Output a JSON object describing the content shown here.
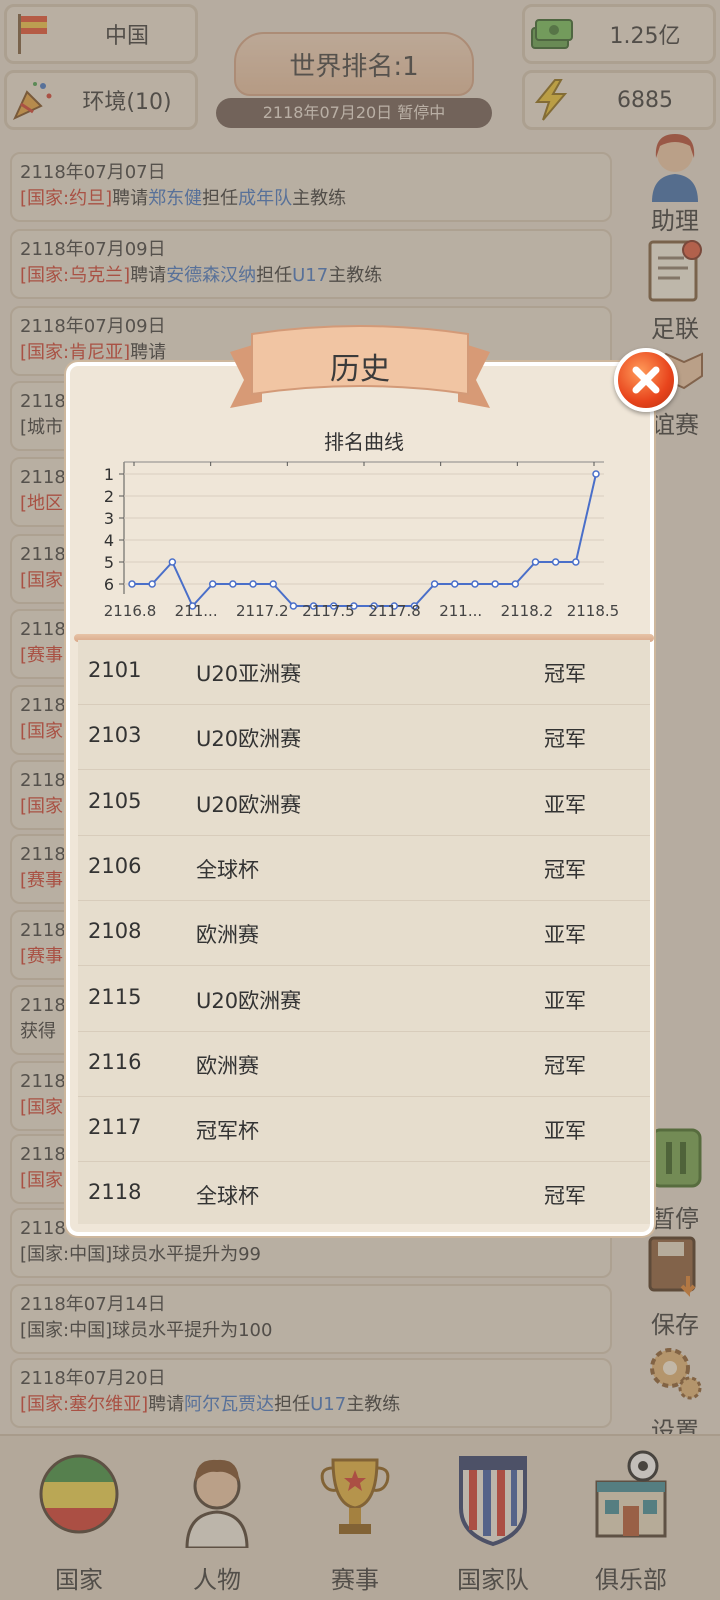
{
  "header": {
    "country": "中国",
    "environment": "环境(10)",
    "money": "1.25亿",
    "energy": "6885",
    "rank_title": "世界排名:1",
    "date_status": "2118年07月20日 暂停中"
  },
  "side_menu": {
    "assistant": "助理",
    "league": "足联",
    "friendly": "谊赛",
    "pause": "暂停",
    "save": "保存",
    "settings": "设置"
  },
  "news": [
    {
      "date": "2118年07月07日",
      "parts": [
        {
          "t": "[国家:约旦]",
          "c": "red"
        },
        {
          "t": "聘请",
          "c": "dark"
        },
        {
          "t": "郑东健",
          "c": "blue"
        },
        {
          "t": "担任",
          "c": "dark"
        },
        {
          "t": "成年队",
          "c": "blue"
        },
        {
          "t": "主教练",
          "c": "dark"
        }
      ]
    },
    {
      "date": "2118年07月09日",
      "parts": [
        {
          "t": "[国家:乌克兰]",
          "c": "red"
        },
        {
          "t": "聘请",
          "c": "dark"
        },
        {
          "t": "安德森汉纳",
          "c": "blue"
        },
        {
          "t": "担任",
          "c": "dark"
        },
        {
          "t": "U17",
          "c": "blue"
        },
        {
          "t": "主教练",
          "c": "dark"
        }
      ]
    },
    {
      "date": "2118年07月09日",
      "parts": [
        {
          "t": "[国家:肯尼亚]",
          "c": "red"
        },
        {
          "t": "聘请",
          "c": "dark"
        }
      ]
    },
    {
      "date": "2118",
      "parts": [
        {
          "t": "[城市",
          "c": "dark"
        }
      ]
    },
    {
      "date": "2118",
      "parts": [
        {
          "t": "[地区",
          "c": "red"
        }
      ]
    },
    {
      "date": "2118",
      "parts": [
        {
          "t": "[国家",
          "c": "red"
        }
      ]
    },
    {
      "date": "2118",
      "parts": [
        {
          "t": "[赛事",
          "c": "red"
        }
      ]
    },
    {
      "date": "2118",
      "parts": [
        {
          "t": "[国家",
          "c": "red"
        }
      ]
    },
    {
      "date": "2118",
      "parts": [
        {
          "t": "[国家",
          "c": "red"
        }
      ]
    },
    {
      "date": "2118",
      "parts": [
        {
          "t": "[赛事",
          "c": "red"
        }
      ]
    },
    {
      "date": "2118",
      "parts": [
        {
          "t": "[赛事",
          "c": "red"
        }
      ]
    },
    {
      "date": "2118",
      "parts": [
        {
          "t": "获得",
          "c": "dark"
        }
      ]
    },
    {
      "date": "2118",
      "parts": [
        {
          "t": "[国家",
          "c": "red"
        }
      ]
    },
    {
      "date": "2118",
      "parts": [
        {
          "t": "[国家",
          "c": "red"
        }
      ]
    },
    {
      "date": "2118年07月14日",
      "parts": [
        {
          "t": "[国家:中国]球员水平提升为99",
          "c": "dark"
        }
      ]
    },
    {
      "date": "2118年07月14日",
      "parts": [
        {
          "t": "[国家:中国]球员水平提升为100",
          "c": "dark"
        }
      ]
    },
    {
      "date": "2118年07月20日",
      "parts": [
        {
          "t": "[国家:塞尔维亚]",
          "c": "red"
        },
        {
          "t": "聘请",
          "c": "dark"
        },
        {
          "t": "阿尔瓦贾达",
          "c": "blue"
        },
        {
          "t": "担任",
          "c": "dark"
        },
        {
          "t": "U17",
          "c": "blue"
        },
        {
          "t": "主教练",
          "c": "dark"
        }
      ]
    }
  ],
  "modal": {
    "title": "历史",
    "chart_title": "排名曲线"
  },
  "chart_data": {
    "type": "line",
    "title": "排名曲线",
    "x_tick_labels": [
      "2116.8",
      "211...",
      "2117.2",
      "2117.5",
      "2117.8",
      "211...",
      "2118.2",
      "2118.5"
    ],
    "y_tick_labels": [
      "1",
      "2",
      "3",
      "4",
      "5",
      "6"
    ],
    "y_inverted": true,
    "ylim": [
      1,
      7
    ],
    "grid": true,
    "series": [
      {
        "color": "#4a6fc9",
        "values": [
          6,
          6,
          5,
          7,
          6,
          6,
          6,
          6,
          7,
          7,
          7,
          7,
          7,
          7,
          7,
          6,
          6,
          6,
          6,
          6,
          5,
          5,
          5,
          1
        ]
      }
    ]
  },
  "history": [
    {
      "year": "2101",
      "event": "U20亚洲赛",
      "result": "冠军"
    },
    {
      "year": "2103",
      "event": "U20欧洲赛",
      "result": "冠军"
    },
    {
      "year": "2105",
      "event": "U20欧洲赛",
      "result": "亚军"
    },
    {
      "year": "2106",
      "event": "全球杯",
      "result": "冠军"
    },
    {
      "year": "2108",
      "event": "欧洲赛",
      "result": "亚军"
    },
    {
      "year": "2115",
      "event": "U20欧洲赛",
      "result": "亚军"
    },
    {
      "year": "2116",
      "event": "欧洲赛",
      "result": "冠军"
    },
    {
      "year": "2117",
      "event": "冠军杯",
      "result": "亚军"
    },
    {
      "year": "2118",
      "event": "全球杯",
      "result": "冠军"
    }
  ],
  "bottom_nav": {
    "country": "国家",
    "people": "人物",
    "events": "赛事",
    "national_team": "国家队",
    "club": "俱乐部"
  },
  "colors": {
    "red_text": "#d23a2a",
    "blue_text": "#3e73c5",
    "line": "#4a6fc9"
  }
}
